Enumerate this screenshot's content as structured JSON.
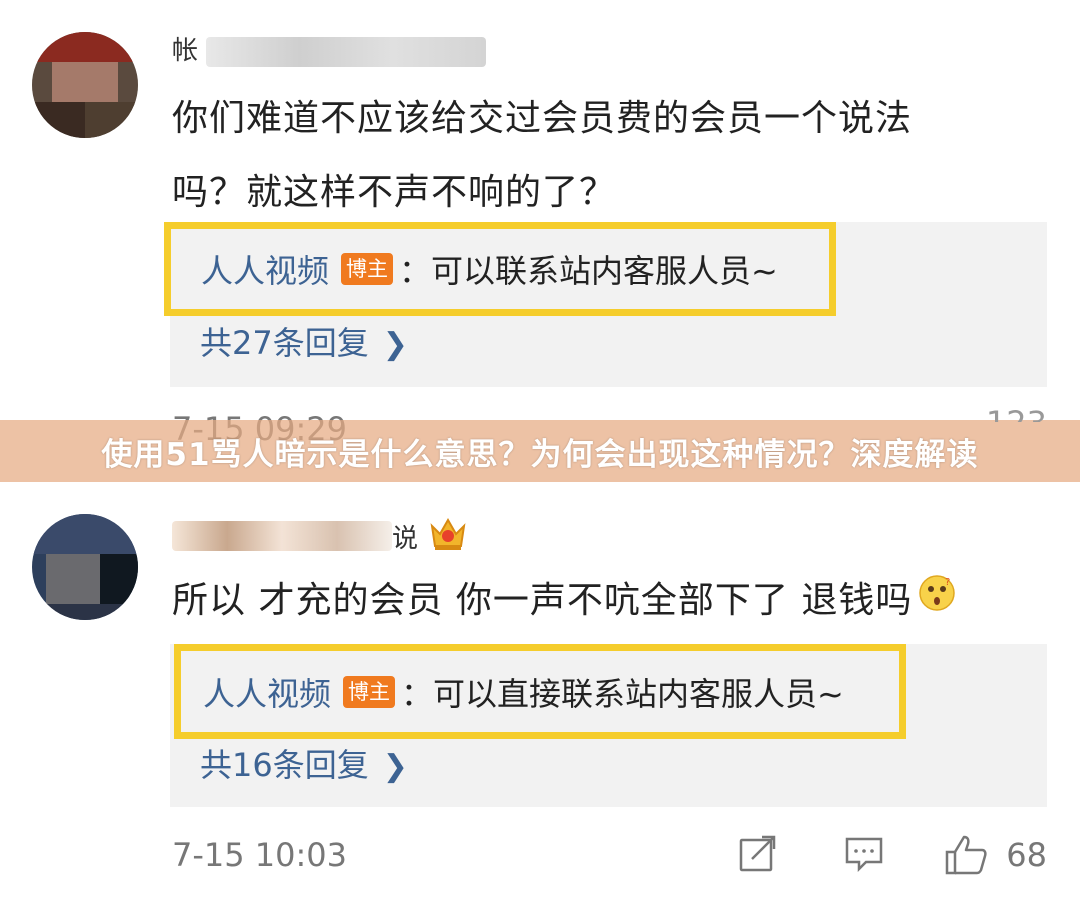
{
  "comments": [
    {
      "username": "帐",
      "text_line1": "你们难道不应该给交过会员费的会员一个说法",
      "text_line2": "吗？就这样不声不响的了？",
      "reply": {
        "author": "人人视频",
        "badge": "博主",
        "text": "：可以联系站内客服人员~"
      },
      "reply_count": "共27条回复",
      "time": "7-15 09:29",
      "likes": "123"
    },
    {
      "username": "说",
      "text": "所以 才充的会员 你一声不吭全部下了 退钱吗",
      "reply": {
        "author": "人人视频",
        "badge": "博主",
        "text": "：可以直接联系站内客服人员~"
      },
      "reply_count": "共16条回复",
      "time": "7-15 10:03",
      "likes": "68"
    }
  ],
  "banner": {
    "title": "使用51骂人暗示是什么意思？为何会出现这种情况？深度解读"
  },
  "colors": {
    "highlight": "#f5cd2c",
    "reply_author": "#3d6393",
    "badge": "#f07a1f",
    "banner_bg": "#e6aa82"
  },
  "icons": [
    "share-icon",
    "comment-icon",
    "like-icon",
    "crown-icon",
    "chevron-right-icon",
    "thinking-emoji-icon"
  ]
}
